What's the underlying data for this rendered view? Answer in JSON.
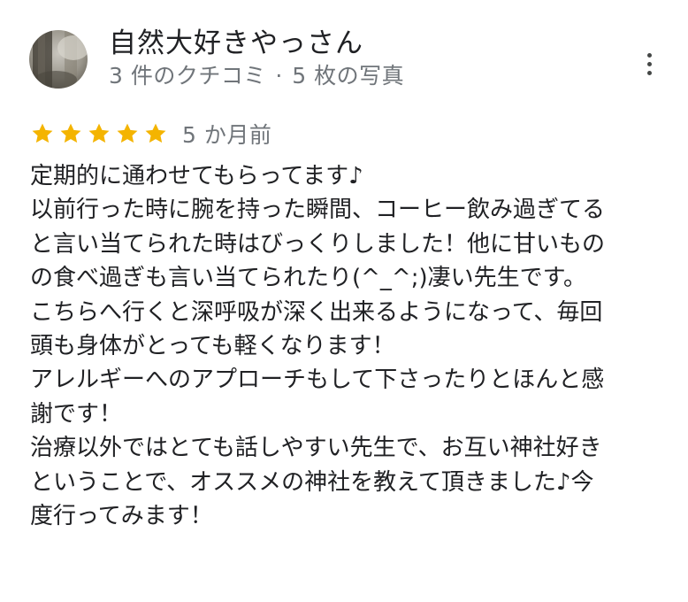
{
  "review": {
    "reviewer_name": "自然大好きやっさん",
    "review_count": "3 件のクチコミ",
    "separator": "·",
    "photo_count": "5 枚の写真",
    "rating": 5,
    "rating_max": 5,
    "date": "5 か月前",
    "more_icon": "more-vertical-icon",
    "star_color": "#f4b400",
    "lines": [
      "定期的に通わせてもらってます♪",
      "以前行った時に腕を持った瞬間、コーヒー飲み過ぎてる",
      "と言い当てられた時はびっくりしました！他に甘いもの",
      "の食べ過ぎも言い当てられたり(^_^;)凄い先生です。",
      "こちらへ行くと深呼吸が深く出来るようになって、毎回",
      "頭も身体がとっても軽くなります！",
      "アレルギーへのアプローチもして下さったりとほんと感",
      "謝です！",
      "治療以外ではとても話しやすい先生で、お互い神社好き",
      "ということで、オススメの神社を教えて頂きました♪今",
      "度行ってみます！"
    ]
  }
}
